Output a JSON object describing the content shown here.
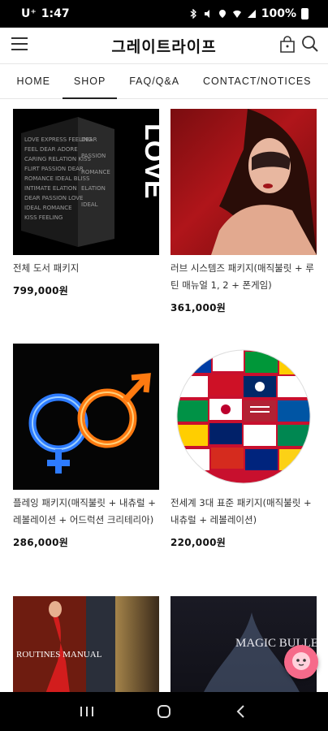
{
  "status_bar": {
    "carrier": "U⁺",
    "time": "1:47",
    "battery": "100%"
  },
  "header": {
    "title": "그레이트라이프"
  },
  "nav": {
    "items": [
      "HOME",
      "SHOP",
      "FAQ/Q&A",
      "CONTACT/NOTICES"
    ],
    "active": "SHOP"
  },
  "products": [
    {
      "name": "전체 도서 패키지",
      "price": "799,000원",
      "image_text": "LOVE"
    },
    {
      "name": "러브 시스템즈 패키지(매직불릿 + 루틴 매뉴얼 1, 2 + 폰게임)",
      "price": "361,000원"
    },
    {
      "name": "플레잉 패키지(매직불릿 + 내츄럴 + 레볼레이션 + 어드럭션 크리테리아)",
      "price": "286,000원"
    },
    {
      "name": "전세계 3대 표준 패키지(매직불릿 + 내츄럴 + 레볼레이션)",
      "price": "220,000원"
    },
    {
      "name": "",
      "price": "",
      "image_text": "ROUTINES MANUAL"
    },
    {
      "name": "",
      "price": "",
      "image_text": "MAGIC BULLETS"
    }
  ],
  "colors": {
    "accent": "#222222",
    "chat_fab": "#f66a8a"
  }
}
